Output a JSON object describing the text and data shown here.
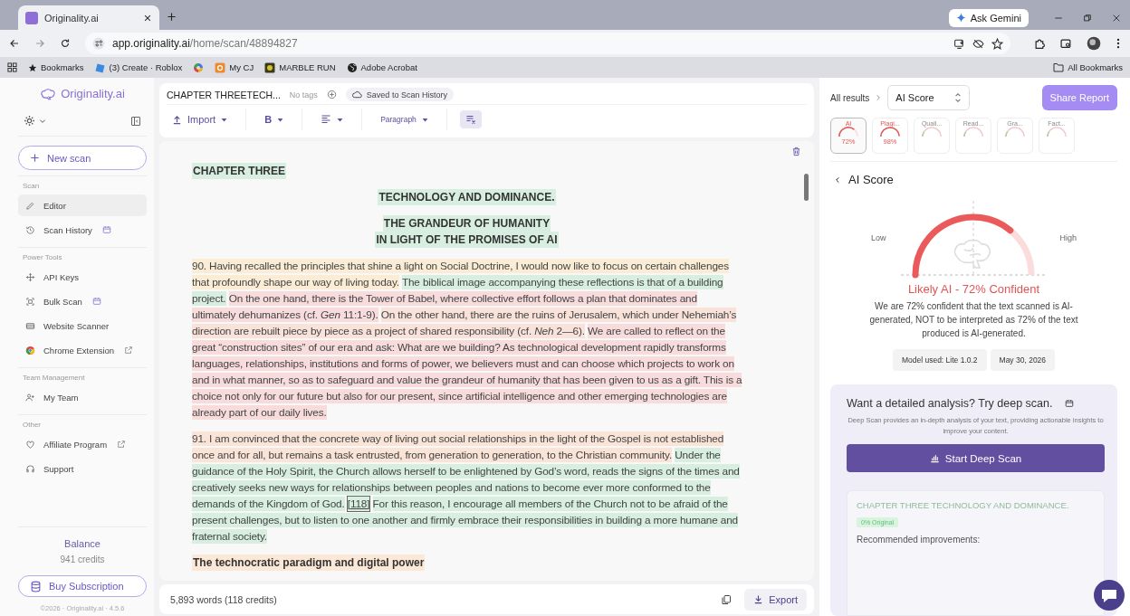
{
  "browser": {
    "tab_title": "Originality.ai",
    "gemini": "Ask Gemini",
    "url_domain": "app.originality.ai",
    "url_path": "/home/scan/48894827",
    "bookmarks": [
      {
        "kind": "star",
        "label": "Bookmarks"
      },
      {
        "kind": "roblox",
        "label": "(3) Create · Roblox"
      },
      {
        "kind": "swirl"
      },
      {
        "kind": "cj",
        "label": "My CJ"
      },
      {
        "kind": "marble",
        "label": "MARBLE RUN"
      },
      {
        "kind": "globe",
        "label": "Adobe Acrobat"
      }
    ],
    "all_bookmarks": "All Bookmarks"
  },
  "sidebar": {
    "brand": "Originality.ai",
    "new_scan": "New scan",
    "sections": [
      {
        "title": "Scan",
        "items": [
          {
            "kind": "pencil",
            "label": "Editor",
            "selected": true,
            "calendar_badge": false,
            "external": false
          },
          {
            "kind": "history",
            "label": "Scan History",
            "selected": false,
            "calendar_badge": true,
            "external": false
          }
        ]
      },
      {
        "title": "Power Tools",
        "items": [
          {
            "kind": "move",
            "label": "API Keys",
            "selected": false,
            "calendar_badge": false,
            "external": false
          },
          {
            "kind": "scan",
            "label": "Bulk Scan",
            "selected": false,
            "calendar_badge": true,
            "external": false
          },
          {
            "kind": "card",
            "label": "Website Scanner",
            "selected": false,
            "calendar_badge": false,
            "external": false
          },
          {
            "kind": "chrome",
            "label": "Chrome Extension",
            "selected": false,
            "calendar_badge": false,
            "external": true
          }
        ]
      },
      {
        "title": "Team Management",
        "items": [
          {
            "kind": "team",
            "label": "My Team",
            "selected": false,
            "calendar_badge": false,
            "external": false
          }
        ]
      },
      {
        "title": "Other",
        "items": [
          {
            "kind": "heart",
            "label": "Affiliate Program",
            "selected": false,
            "calendar_badge": false,
            "external": true
          },
          {
            "kind": "headset",
            "label": "Support",
            "selected": false,
            "calendar_badge": false,
            "external": false
          }
        ]
      }
    ],
    "balance_label": "Balance",
    "balance": "941 credits",
    "buy": "Buy Subscription",
    "footer": "©2026 · Originality.ai · 4.5.6"
  },
  "editor": {
    "title": "CHAPTER THREETECH...",
    "tags": "No tags",
    "saved": "Saved to Scan History",
    "import": "Import",
    "bold": "B",
    "style": "Paragraph",
    "clear_format_on": true,
    "blocks": [
      {
        "kind": "heading-left",
        "lines": [
          "CHAPTER THREE"
        ],
        "color": "#d7eee0"
      },
      {
        "kind": "heading-center",
        "lines": [
          "TECHNOLOGY AND DOMINANCE."
        ],
        "color": "#d7eee0"
      },
      {
        "kind": "heading-center",
        "lines": [
          "THE GRANDEUR OF HUMANITY",
          "IN LIGHT OF THE PROMISES OF AI"
        ],
        "color": "#d7eee0"
      },
      {
        "kind": "paragraph",
        "lines": [
          [
            {
              "kind": "text",
              "color": "#fbecd6",
              "text": "90. Having recalled the principles that shine a light on Social Doctrine, I would now like to focus on certain challenges"
            }
          ],
          [
            {
              "kind": "text",
              "color": "#fbecd6",
              "text": "that profoundly shape our way of living today."
            },
            {
              "kind": "text",
              "color": "#d7eee0",
              "text": "The biblical image accompanying these reflections is that of a building"
            }
          ],
          [
            {
              "kind": "text",
              "color": "#d7eee0",
              "text": "project."
            },
            {
              "kind": "text",
              "color": "#f8dcdc",
              "text": "On the one hand, there is the Tower of Babel, where collective effort follows a plan that dominates and"
            }
          ],
          [
            {
              "kind": "text",
              "color": "#f8dcdc",
              "text": "ultimately dehumanizes (cf. *Gen* 11:1-9)."
            },
            {
              "kind": "text",
              "color": "#f9e2da",
              "text": "On the other hand, there are the ruins of Jerusalem, which under Nehemiah’s"
            }
          ],
          [
            {
              "kind": "text",
              "color": "#f9e2da",
              "text": "direction are rebuilt piece by piece as a project of shared responsibility (cf. *Neh* 2—6)."
            },
            {
              "kind": "text",
              "color": "#f8dcdc",
              "text": "We are called to reflect on the"
            }
          ],
          [
            {
              "kind": "text",
              "color": "#f8dcdc",
              "text": "great “construction sites” of our era and ask: What are we building? As technological development rapidly transforms"
            }
          ],
          [
            {
              "kind": "text",
              "color": "#f8dcdc",
              "text": "languages, relationships, institutions and forms of power, we believers must and can choose which projects to work on"
            }
          ],
          [
            {
              "kind": "text",
              "color": "#f8dcdc",
              "text": "and in what manner, so as to safeguard and value the grandeur of humanity that has been given to us as a gift. This is a"
            }
          ],
          [
            {
              "kind": "text",
              "color": "#f8dcdc",
              "text": "choice not only for our future but also for our present, since artificial intelligence and other emerging technologies are"
            }
          ],
          [
            {
              "kind": "text",
              "color": "#f8dcdc",
              "text": "already part of our daily lives."
            }
          ]
        ]
      },
      {
        "kind": "paragraph",
        "lines": [
          [
            {
              "kind": "text",
              "color": "#fae4d7",
              "text": "91. I am convinced that the concrete way of living out social relationships in the light of the Gospel is not established"
            }
          ],
          [
            {
              "kind": "text",
              "color": "#fae4d7",
              "text": "once and for all, but remains a task entrusted, from generation to generation, to the Christian community."
            },
            {
              "kind": "text",
              "color": "#d7eee0",
              "text": "Under the"
            }
          ],
          [
            {
              "kind": "text",
              "color": "#d7eee0",
              "text": "guidance of the Holy Spirit, the Church allows herself to be enlightened by God’s word, reads the signs of the times and"
            }
          ],
          [
            {
              "kind": "text",
              "color": "#d7eee0",
              "text": "creatively seeks new ways for relationships between peoples and nations to become ever more conformed to the"
            }
          ],
          [
            {
              "kind": "text",
              "color": "#d7eee0",
              "text": "demands of the Kingdom of God."
            },
            {
              "kind": "ref",
              "color": "#d7eee0",
              "text": "[118]"
            },
            {
              "kind": "text",
              "color": "#d7eee0",
              "text": "For this reason, I encourage all members of the Church not to be afraid of the"
            }
          ],
          [
            {
              "kind": "text",
              "color": "#d7eee0",
              "text": "present challenges, but to listen to one another and firmly embrace their responsibilities in building a more humane and"
            }
          ],
          [
            {
              "kind": "text",
              "color": "#d7eee0",
              "text": "fraternal society."
            }
          ]
        ]
      },
      {
        "kind": "subheading",
        "lines": [
          "The technocratic paradigm and digital power"
        ],
        "color": "#fbe8d6"
      }
    ],
    "word_count": "5,893 words (118 credits)",
    "export": "Export"
  },
  "results": {
    "breadcrumb": "All results",
    "select": "AI Score",
    "share": "Share Report",
    "score_tabs": [
      {
        "label": "AI",
        "value": "72%",
        "selected": true,
        "dimmed": false
      },
      {
        "label": "Plagi...",
        "value": "98%",
        "selected": false,
        "dimmed": false
      },
      {
        "label": "Quali...",
        "selected": false,
        "dimmed": true
      },
      {
        "label": "Read...",
        "selected": false,
        "dimmed": true
      },
      {
        "label": "Gra...",
        "selected": false,
        "dimmed": true
      },
      {
        "label": "Fact...",
        "selected": false,
        "dimmed": true
      }
    ],
    "back": "AI Score",
    "low": "Low",
    "high": "High",
    "verdict": "Likely AI - 72% Confident",
    "description": "We are 72% confident that the text scanned is AI-generated, NOT to be interpreted as 72% of the text produced is AI-generated.",
    "chips": [
      "Model used: Lite 1.0.2",
      "May 30, 2026"
    ],
    "deep": {
      "title": "Want a detailed analysis? Try deep scan.",
      "description": "Deep Scan provides an in-depth analysis of your text, providing actionable insights to improve your content.",
      "button": "Start Deep Scan",
      "preview_heading": "CHAPTER THREE TECHNOLOGY AND DOMINANCE.",
      "preview_badge": "0% Original",
      "preview_title": "Recommended improvements:"
    }
  }
}
